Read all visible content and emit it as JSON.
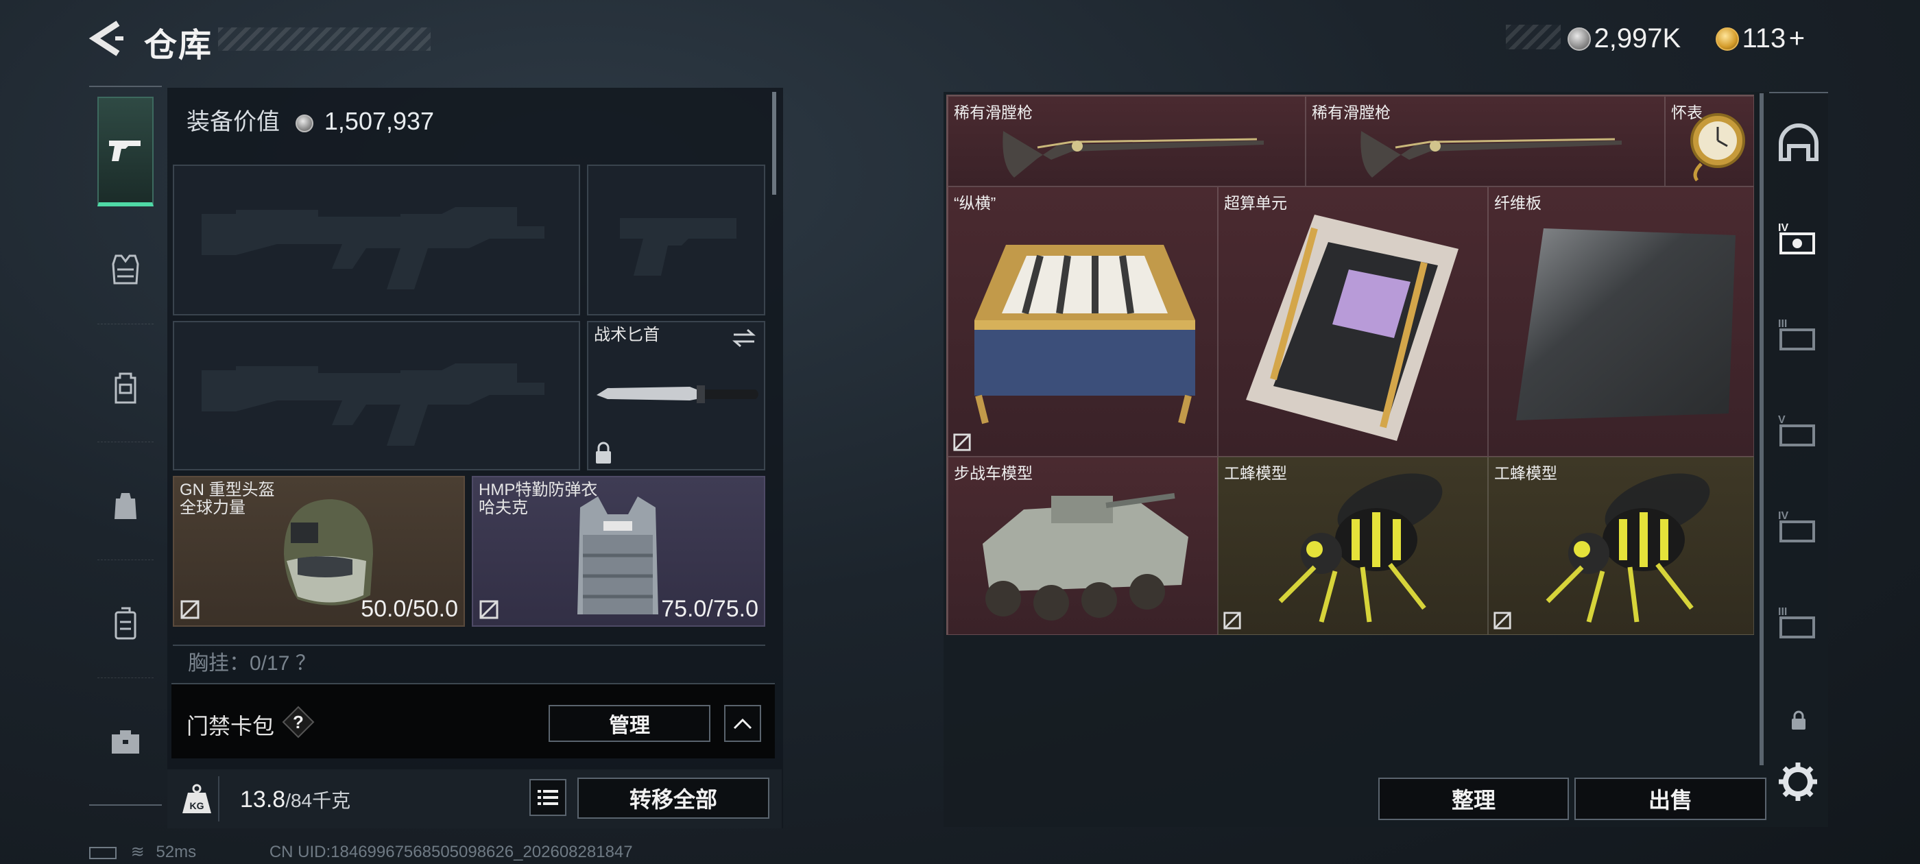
{
  "header": {
    "title": "仓库",
    "silver_amount": "2,997K",
    "gold_amount": "113",
    "gold_add": "+"
  },
  "equipment": {
    "value_label": "装备价值",
    "value": "1,507,937",
    "melee_label": "战术匕首",
    "helmet_name_line1": "GN 重型头盔",
    "helmet_name_line2": "全球力量",
    "helmet_durability": "50.0/50.0",
    "armor_name_line1": "HMP特勤防弹衣",
    "armor_name_line2": "哈夫克",
    "armor_durability": "75.0/75.0",
    "chest_rig_partial": "胸挂：0/17 ？"
  },
  "keycard": {
    "label": "门禁卡包",
    "help": "?",
    "manage_label": "管理"
  },
  "weight": {
    "current": "13.8",
    "max_unit": "/84千克",
    "transfer_all_label": "转移全部"
  },
  "status": {
    "ping": "52ms",
    "uid": "CN UID:18469967568505098626_202608281847"
  },
  "stash": {
    "items": [
      {
        "label": "稀有滑膛枪",
        "bg": "red"
      },
      {
        "label": "稀有滑膛枪",
        "bg": "red"
      },
      {
        "label": "怀表",
        "bg": "red"
      },
      {
        "label": "“纵横”",
        "bg": "red"
      },
      {
        "label": "超算单元",
        "bg": "red"
      },
      {
        "label": "纤维板",
        "bg": "red"
      },
      {
        "label": "步战车模型",
        "bg": "red"
      },
      {
        "label": "工蜂模型",
        "bg": "olive"
      },
      {
        "label": "工蜂模型",
        "bg": "olive"
      }
    ],
    "sort_label": "整理",
    "sell_label": "出售"
  },
  "right_tabs": [
    "home",
    "IV",
    "III",
    "V",
    "IV",
    "III",
    "lock"
  ],
  "colors": {
    "accent_green": "#4fd9a6",
    "rare_red": "#4a2a30",
    "olive": "#3e3826"
  }
}
